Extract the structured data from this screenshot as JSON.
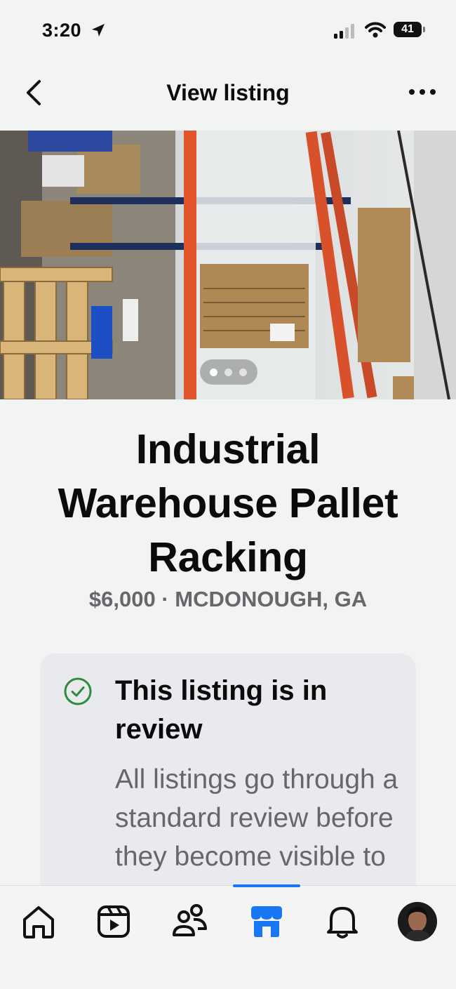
{
  "status_bar": {
    "time": "3:20",
    "battery": "41",
    "icons": [
      "location-arrow-icon",
      "cellular-signal-icon",
      "wifi-icon",
      "battery-icon"
    ]
  },
  "header": {
    "title": "View listing",
    "back_icon": "chevron-left-icon",
    "more_icon": "more-horizontal-icon"
  },
  "listing": {
    "photo_icon": "listing-photo",
    "photo_count": 3,
    "active_photo": 1,
    "title": "Industrial Warehouse Pallet Racking",
    "meta": "$6,000 · MCDONOUGH, GA"
  },
  "review": {
    "icon": "check-circle-icon",
    "heading": "This listing is in review",
    "body": "All listings go through a standard review before they become visible to"
  },
  "bottom_nav": {
    "items": [
      {
        "icon": "home-icon"
      },
      {
        "icon": "video-icon"
      },
      {
        "icon": "friends-icon"
      },
      {
        "icon": "marketplace-icon",
        "active": true
      },
      {
        "icon": "bell-icon"
      },
      {
        "icon": "profile-avatar"
      }
    ],
    "accent_color": "#1877f2"
  },
  "colors": {
    "background": "#f2f3f3",
    "card": "#e9eaee",
    "secondary_text": "#65676b",
    "success_green": "#2e8b3d"
  }
}
